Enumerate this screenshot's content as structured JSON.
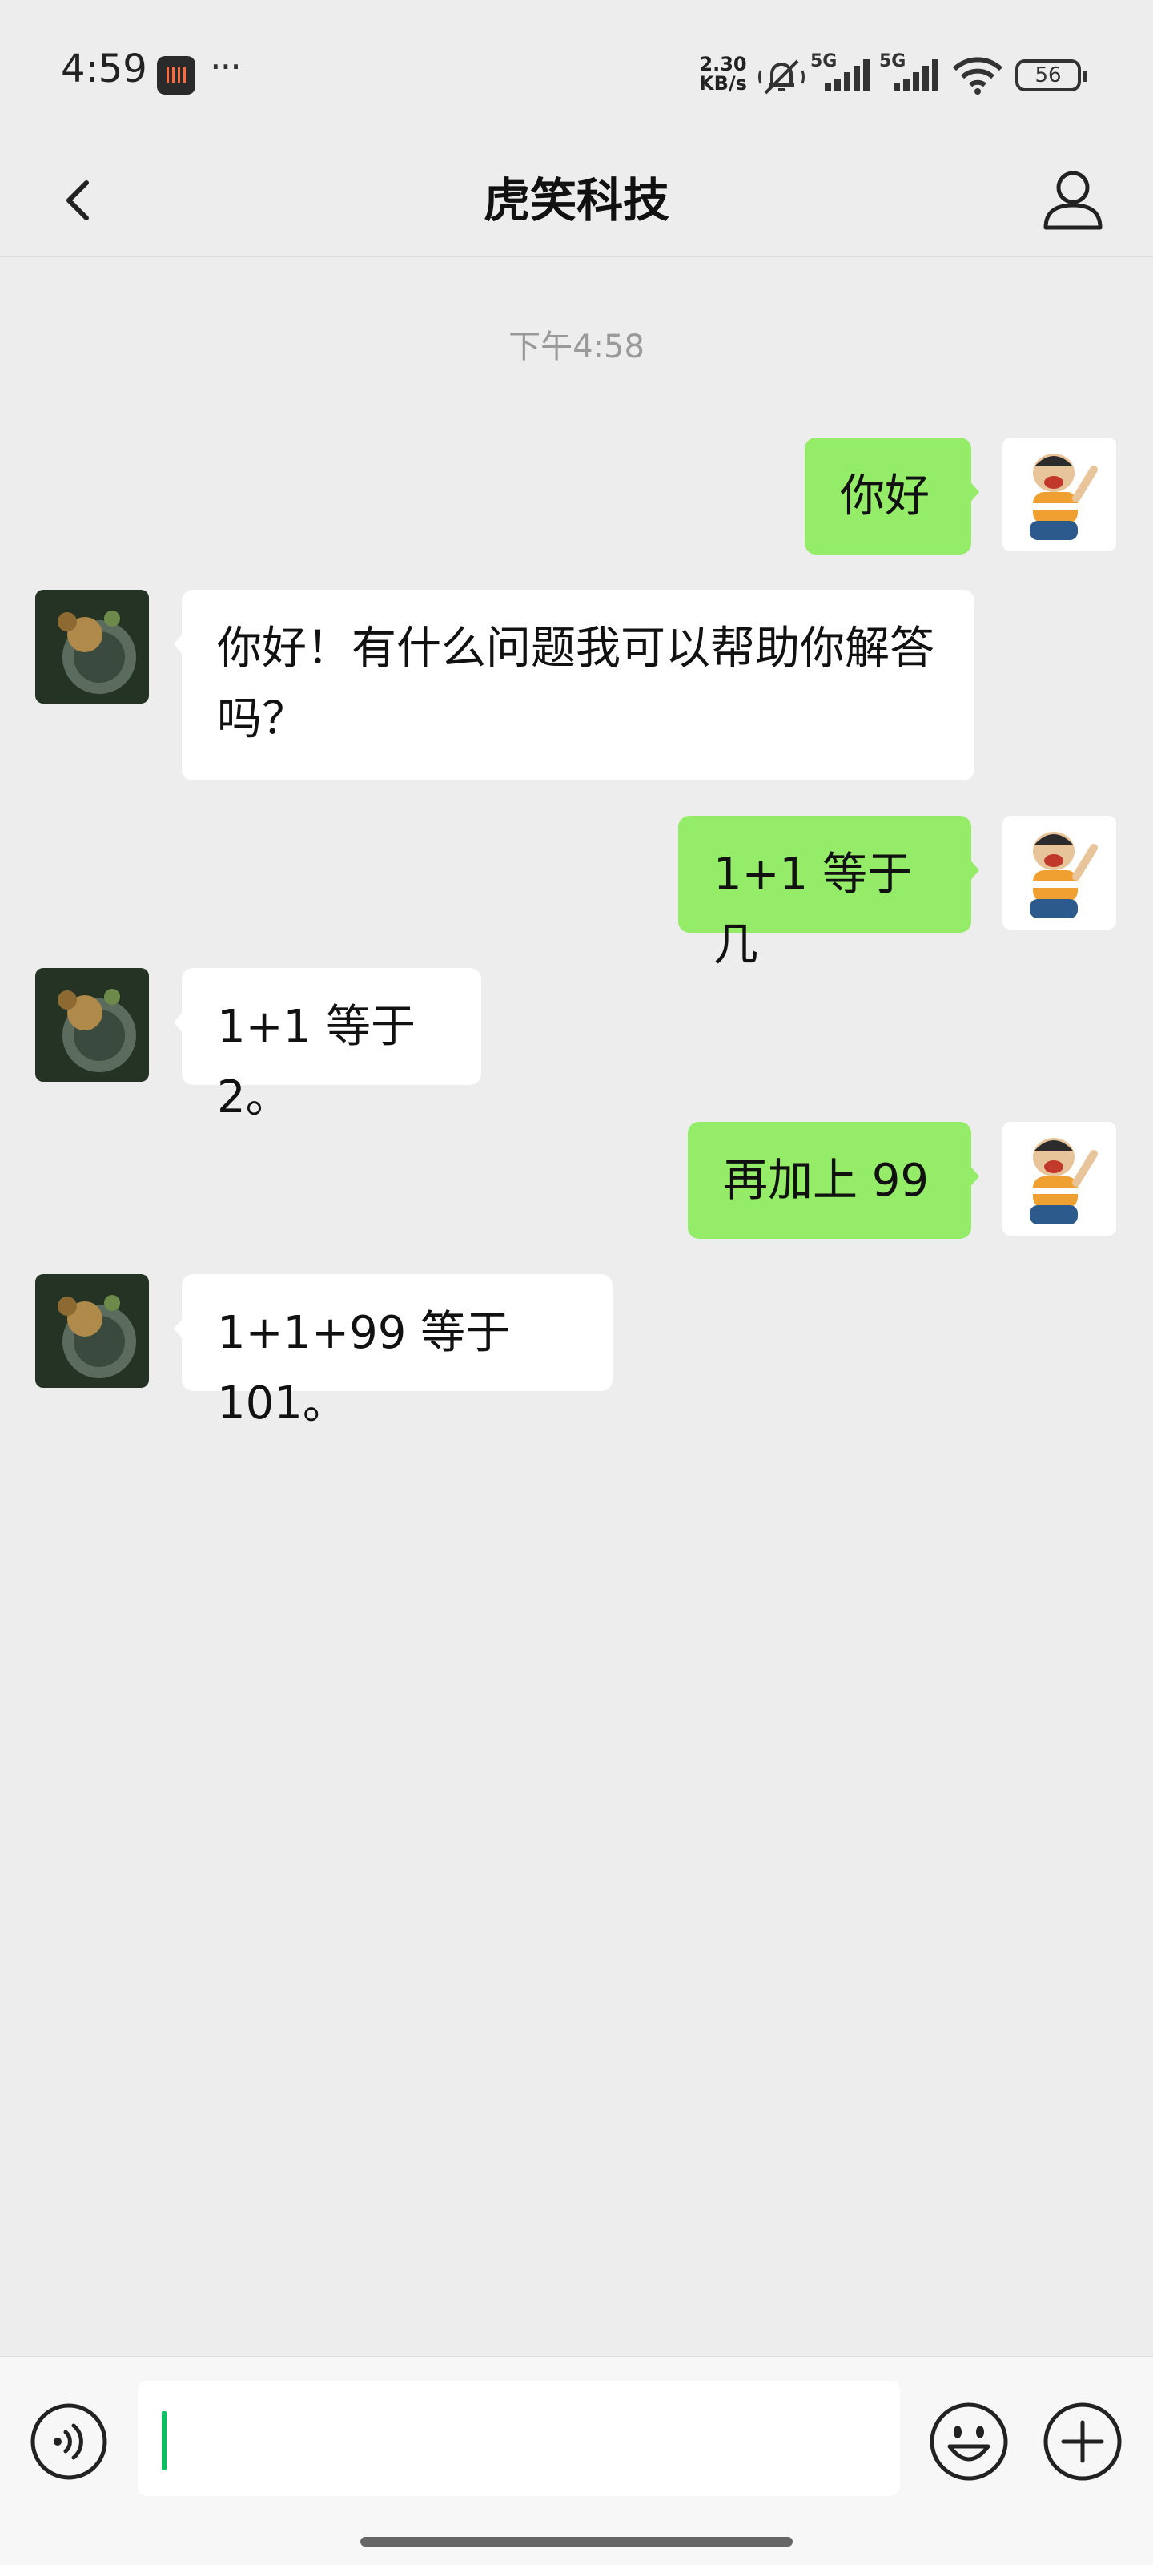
{
  "status_bar": {
    "time": "4:59",
    "net_speed_value": "2.30",
    "net_speed_unit": "KB/s",
    "signal_1_label": "5G",
    "signal_2_label": "5G",
    "battery": "56",
    "icons": [
      "recorder-icon",
      "more-dots-icon",
      "mute-bell-icon",
      "signal-icon",
      "wifi-icon",
      "battery-icon"
    ]
  },
  "nav": {
    "title": "虎笑科技",
    "back_icon": "chevron-left-icon",
    "profile_icon": "person-icon"
  },
  "chat": {
    "timestamp": "下午4:58",
    "messages": [
      {
        "from": "me",
        "text": "你好"
      },
      {
        "from": "other",
        "text": "你好！有什么问题我可以帮助你解答吗？"
      },
      {
        "from": "me",
        "text": "1+1 等于几"
      },
      {
        "from": "other",
        "text": "1+1 等于 2。"
      },
      {
        "from": "me",
        "text": "再加上 99"
      },
      {
        "from": "other",
        "text": "1+1+99 等于 101。"
      }
    ]
  },
  "input_bar": {
    "value": "",
    "icons": [
      "voice-icon",
      "emoji-icon",
      "plus-icon"
    ]
  },
  "colors": {
    "background": "#ededed",
    "my_bubble": "#95ec69",
    "other_bubble": "#ffffff",
    "caret": "#07c160"
  }
}
